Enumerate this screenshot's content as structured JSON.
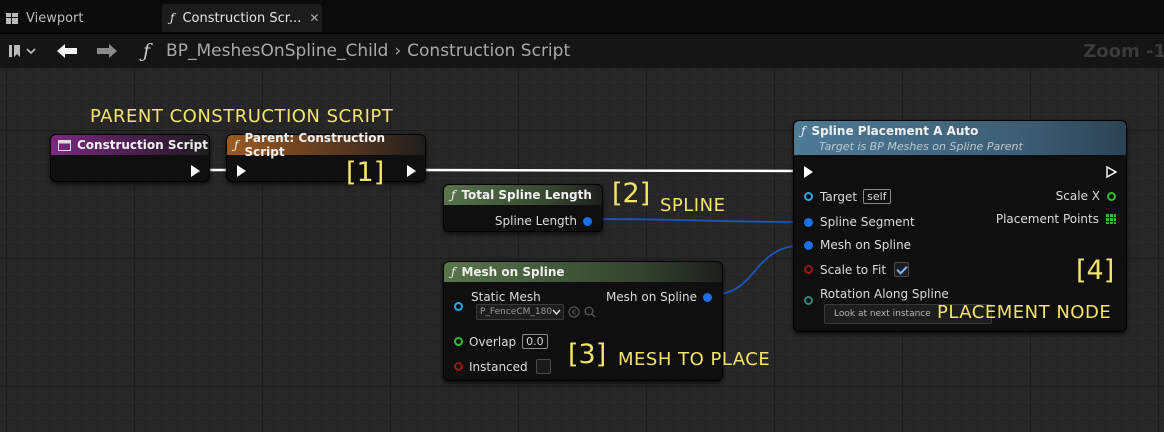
{
  "tabs": [
    {
      "label": "Viewport",
      "icon": "viewport-grid-icon",
      "active": false
    },
    {
      "label": "Construction Scr...",
      "icon": "function-icon",
      "active": true
    }
  ],
  "toolbar": {
    "breadcrumb_blueprint": "BP_MeshesOnSpline_Child",
    "breadcrumb_graph": "Construction Script",
    "zoom": "Zoom -1"
  },
  "annotations": {
    "parent_caption": "PARENT CONSTRUCTION SCRIPT",
    "n1": "[1]",
    "n2": "[2]",
    "spline_caption": "SPLINE",
    "n3": "[3]",
    "mesh_caption": "MESH TO PLACE",
    "n4": "[4]",
    "placement_caption": "PLACEMENT NODE"
  },
  "nodes": {
    "construction_script": {
      "title": "Construction Script"
    },
    "parent_construction": {
      "title": "Parent: Construction Script"
    },
    "total_spline_length": {
      "title": "Total Spline Length",
      "out_pin": "Spline Length"
    },
    "mesh_on_spline": {
      "title": "Mesh on Spline",
      "static_mesh_label": "Static Mesh",
      "static_mesh_value": "P_FenceCM_180",
      "out_pin": "Mesh on Spline",
      "overlap_label": "Overlap",
      "overlap_value": "0.0",
      "instanced_label": "Instanced",
      "instanced_checked": false
    },
    "spline_placement": {
      "title": "Spline Placement A Auto",
      "subtitle": "Target is BP Meshes on Spline Parent",
      "target_label": "Target",
      "target_value": "self",
      "spline_segment_label": "Spline Segment",
      "mesh_on_spline_label": "Mesh on Spline",
      "scale_to_fit_label": "Scale to Fit",
      "scale_to_fit_checked": true,
      "rotation_label": "Rotation Along Spline",
      "rotation_value": "Look at next instance",
      "scale_x_label": "Scale X",
      "placement_points_label": "Placement Points"
    }
  },
  "colors": {
    "annotation": "#f3e36a",
    "object_pin": "#1a6fe6",
    "float_pin": "#2ebf2e",
    "bool_pin": "#9a1616",
    "exec_wire": "#ffffff"
  }
}
